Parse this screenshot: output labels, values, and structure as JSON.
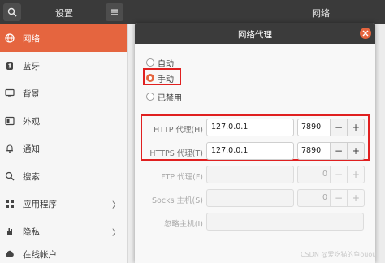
{
  "topbar": {
    "left_title": "设置",
    "right_title": "网络"
  },
  "sidebar": {
    "items": [
      {
        "label": "网络",
        "icon": "globe-icon",
        "active": true
      },
      {
        "label": "蓝牙",
        "icon": "bluetooth-icon"
      },
      {
        "label": "背景",
        "icon": "monitor-icon"
      },
      {
        "label": "外观",
        "icon": "appearance-icon"
      },
      {
        "label": "通知",
        "icon": "bell-icon"
      },
      {
        "label": "搜索",
        "icon": "search-icon"
      },
      {
        "label": "应用程序",
        "icon": "apps-icon",
        "chevron": "〉"
      },
      {
        "label": "隐私",
        "icon": "hand-icon",
        "chevron": "〉"
      },
      {
        "label": "在线帐户",
        "icon": "cloud-icon"
      }
    ]
  },
  "dialog": {
    "title": "网络代理",
    "methods": [
      {
        "label": "自动",
        "checked": false
      },
      {
        "label": "手动",
        "checked": true
      },
      {
        "label": "已禁用",
        "checked": false
      }
    ],
    "fields": [
      {
        "label": "HTTP 代理(H)",
        "host": "127.0.0.1",
        "port": "7890",
        "dim": false
      },
      {
        "label": "HTTPS 代理(T)",
        "host": "127.0.0.1",
        "port": "7890",
        "dim": false
      },
      {
        "label": "FTP 代理(F)",
        "host": "",
        "port": "0",
        "dim": true
      },
      {
        "label": "Socks 主机(S)",
        "host": "",
        "port": "0",
        "dim": true
      },
      {
        "label": "忽略主机(I)",
        "host": "",
        "dim": true
      }
    ],
    "minus": "−",
    "plus": "+"
  },
  "watermark": "CSDN @爱吃猫的鱼ouou",
  "colors": {
    "accent": "#e5653f",
    "highlight_box": "#e02020",
    "header": "#3a3a3a"
  }
}
